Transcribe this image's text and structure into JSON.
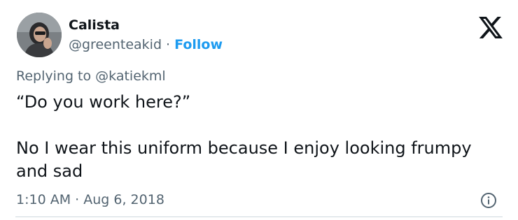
{
  "author": {
    "display_name": "Calista",
    "handle": "@greenteakid",
    "separator": "·",
    "follow_label": "Follow",
    "avatar_icon": "user-avatar"
  },
  "brand": {
    "logo_icon": "x-logo-icon"
  },
  "reply": {
    "prefix": "Replying to",
    "to_handle": "@katiekml"
  },
  "tweet": {
    "line1": "“Do you work here?”",
    "line2": "No I wear this uniform because I enjoy looking frumpy and sad"
  },
  "meta": {
    "time": "1:10 AM",
    "separator": "·",
    "date": "Aug 6, 2018",
    "info_icon": "info-icon"
  },
  "colors": {
    "accent": "#1d9bf0",
    "text": "#0f1419",
    "muted": "#536471",
    "divider": "#cfd9de"
  }
}
